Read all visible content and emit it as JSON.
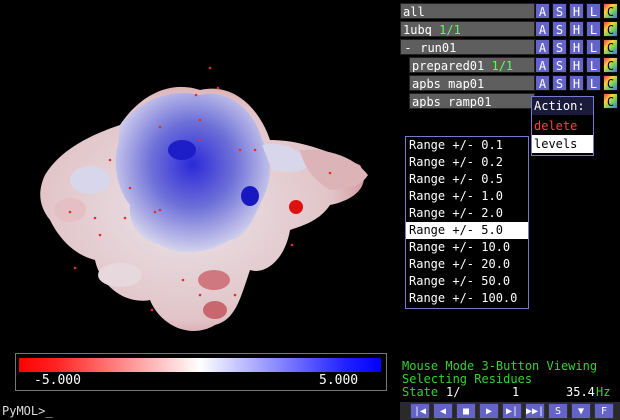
{
  "viewer": {
    "colorbar": {
      "min_label": "-5.000",
      "max_label": "5.000"
    }
  },
  "command_line": {
    "prompt": "PyMOL>_"
  },
  "object_panel": {
    "rows": [
      {
        "name": "all",
        "count": ""
      },
      {
        "name": "1ubq",
        "count": "1/1"
      },
      {
        "name": "run01",
        "count": "",
        "prefix": "-"
      },
      {
        "name": "prepared01",
        "count": "1/1"
      },
      {
        "name": "apbs_map01",
        "count": ""
      },
      {
        "name": "apbs_ramp01",
        "count": ""
      }
    ],
    "buttons": [
      "A",
      "S",
      "H",
      "L",
      "C"
    ]
  },
  "action_popup": {
    "title": "Action:",
    "delete": "delete",
    "levels": "levels"
  },
  "levels_menu": {
    "items": [
      "Range +/- 0.1",
      "Range +/- 0.2",
      "Range +/- 0.5",
      "Range +/- 1.0",
      "Range +/- 2.0",
      "Range +/- 5.0",
      "Range +/- 10.0",
      "Range +/- 20.0",
      "Range +/- 50.0",
      "Range +/- 100.0"
    ],
    "selected_index": 5
  },
  "status": {
    "mouse_mode": "Mouse Mode 3-Button Viewing",
    "selecting": "Selecting Residues",
    "state_label": "State",
    "state_value": "1/",
    "state_total": "1",
    "fps": "35.4",
    "fps_unit": "Hz"
  },
  "vcr_buttons": [
    "|◀",
    "◀",
    "■",
    "▶",
    "▶|",
    "▶▶|",
    "S",
    "▼",
    "F"
  ]
}
